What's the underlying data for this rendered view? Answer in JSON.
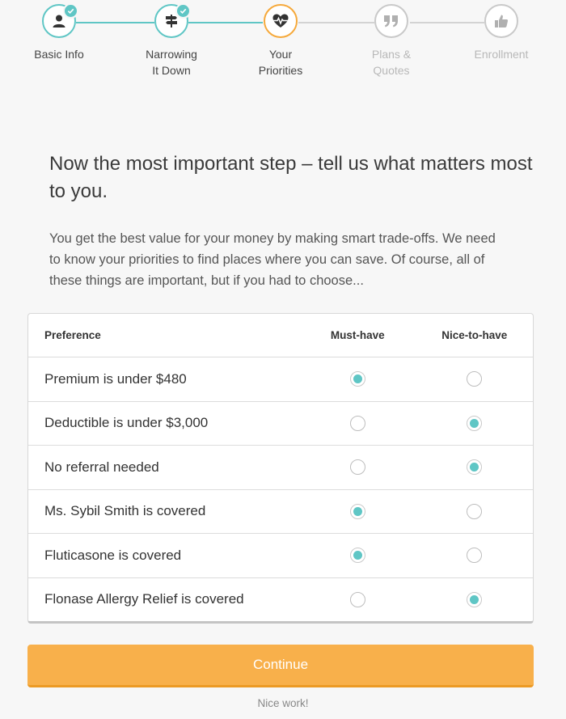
{
  "stepper": {
    "steps": [
      {
        "line1": "Basic Info",
        "line2": "",
        "icon": "user-icon",
        "state": "complete"
      },
      {
        "line1": "Narrowing",
        "line2": "It Down",
        "icon": "signpost-icon",
        "state": "complete"
      },
      {
        "line1": "Your",
        "line2": "Priorities",
        "icon": "heartbeat-icon",
        "state": "active"
      },
      {
        "line1": "Plans &",
        "line2": "Quotes",
        "icon": "quote-icon",
        "state": "pending"
      },
      {
        "line1": "Enrollment",
        "line2": "",
        "icon": "thumbs-up-icon",
        "state": "pending"
      }
    ],
    "colors": {
      "complete": "#5fc6c5",
      "active": "#f6a93b",
      "pending": "#c9c9c9"
    }
  },
  "heading": "Now the most important step – tell us what matters most to you.",
  "intro": "You get the best value for your money by making smart trade-offs. We need to know your priorities to find places where you can save. Of course, all of these things are important, but if you had to choose...",
  "table": {
    "headers": {
      "preference": "Preference",
      "must": "Must-have",
      "nice": "Nice-to-have"
    },
    "rows": [
      {
        "label": "Premium is under $480",
        "selection": "must"
      },
      {
        "label": "Deductible is under $3,000",
        "selection": "nice"
      },
      {
        "label": "No referral needed",
        "selection": "nice"
      },
      {
        "label": "Ms. Sybil Smith is covered",
        "selection": "must"
      },
      {
        "label": "Fluticasone is covered",
        "selection": "must"
      },
      {
        "label": "Flonase Allergy Relief is covered",
        "selection": "nice"
      }
    ]
  },
  "continue_label": "Continue",
  "footnote": "Nice work!",
  "accent_colors": {
    "teal": "#5fc6c5",
    "orange": "#f8b04b"
  }
}
